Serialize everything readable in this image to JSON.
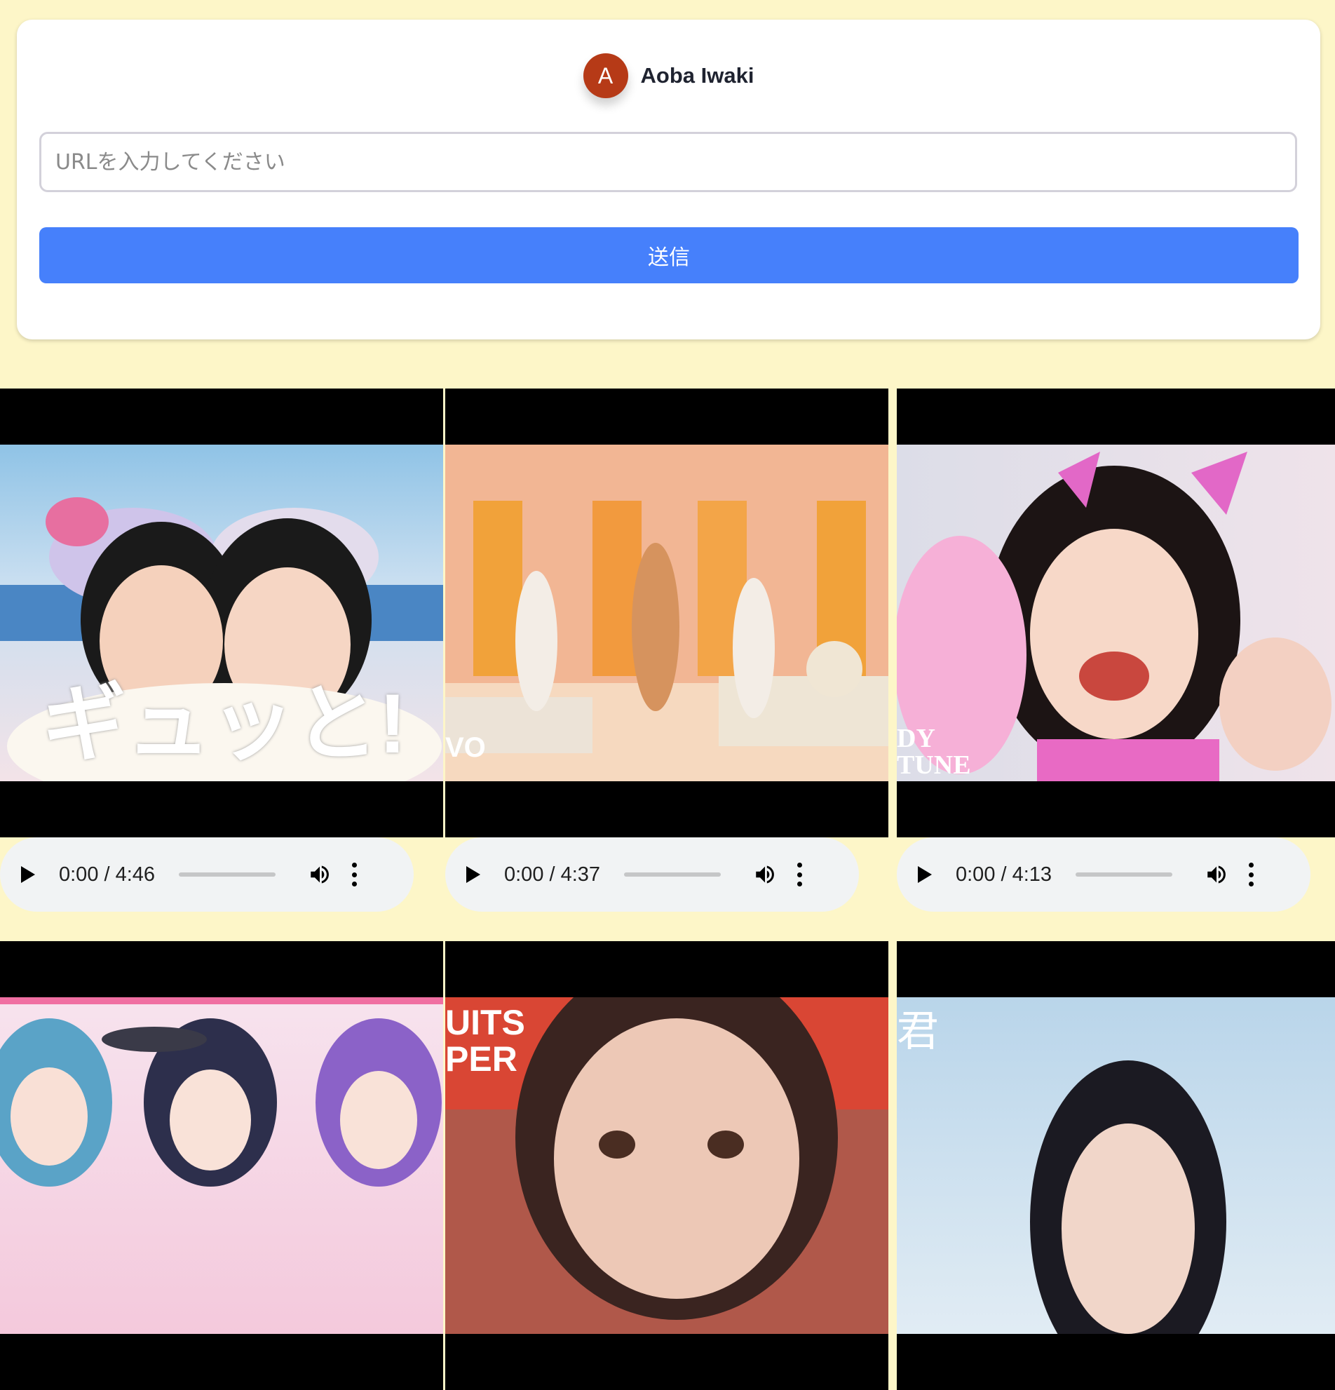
{
  "user": {
    "avatar_letter": "A",
    "name": "Aoba Iwaki"
  },
  "form": {
    "url_placeholder": "URLを入力してください",
    "url_value": "",
    "submit_label": "送信"
  },
  "videos": [
    {
      "caption": "ギュッと!",
      "time": "0:00 / 4:46",
      "thumb_bg": "#9fc8e4"
    },
    {
      "caption": "VO",
      "time": "0:00 / 4:37",
      "thumb_bg": "#f2b58f"
    },
    {
      "caption": "DY TUNE",
      "time": "0:00 / 4:13",
      "thumb_bg": "#e8d6e6"
    },
    {
      "caption": "",
      "time": "",
      "thumb_bg": "#f4c9d8"
    },
    {
      "caption": "UITS PER",
      "time": "",
      "thumb_bg": "#c97a6a"
    },
    {
      "caption": "君",
      "time": "",
      "thumb_bg": "#bcd6ea"
    }
  ]
}
